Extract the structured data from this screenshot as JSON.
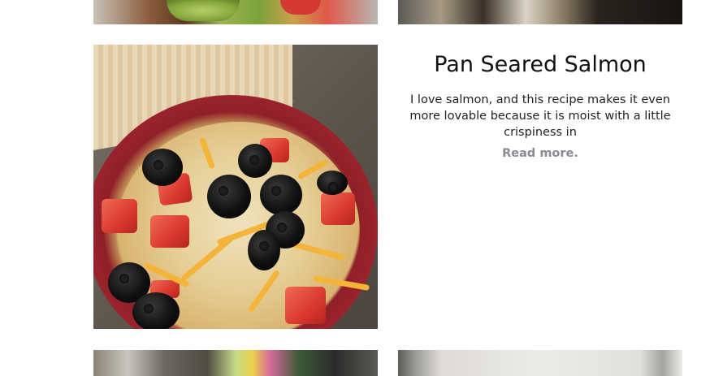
{
  "post": {
    "title": "Pan Seared Salmon",
    "excerpt": "I love salmon, and this recipe makes it even more lovable because it is moist with a little crispiness in",
    "read_more_label": "Read more."
  },
  "colors": {
    "read_more": "#8a8a96",
    "title": "#111111",
    "background": "#ffffff"
  }
}
